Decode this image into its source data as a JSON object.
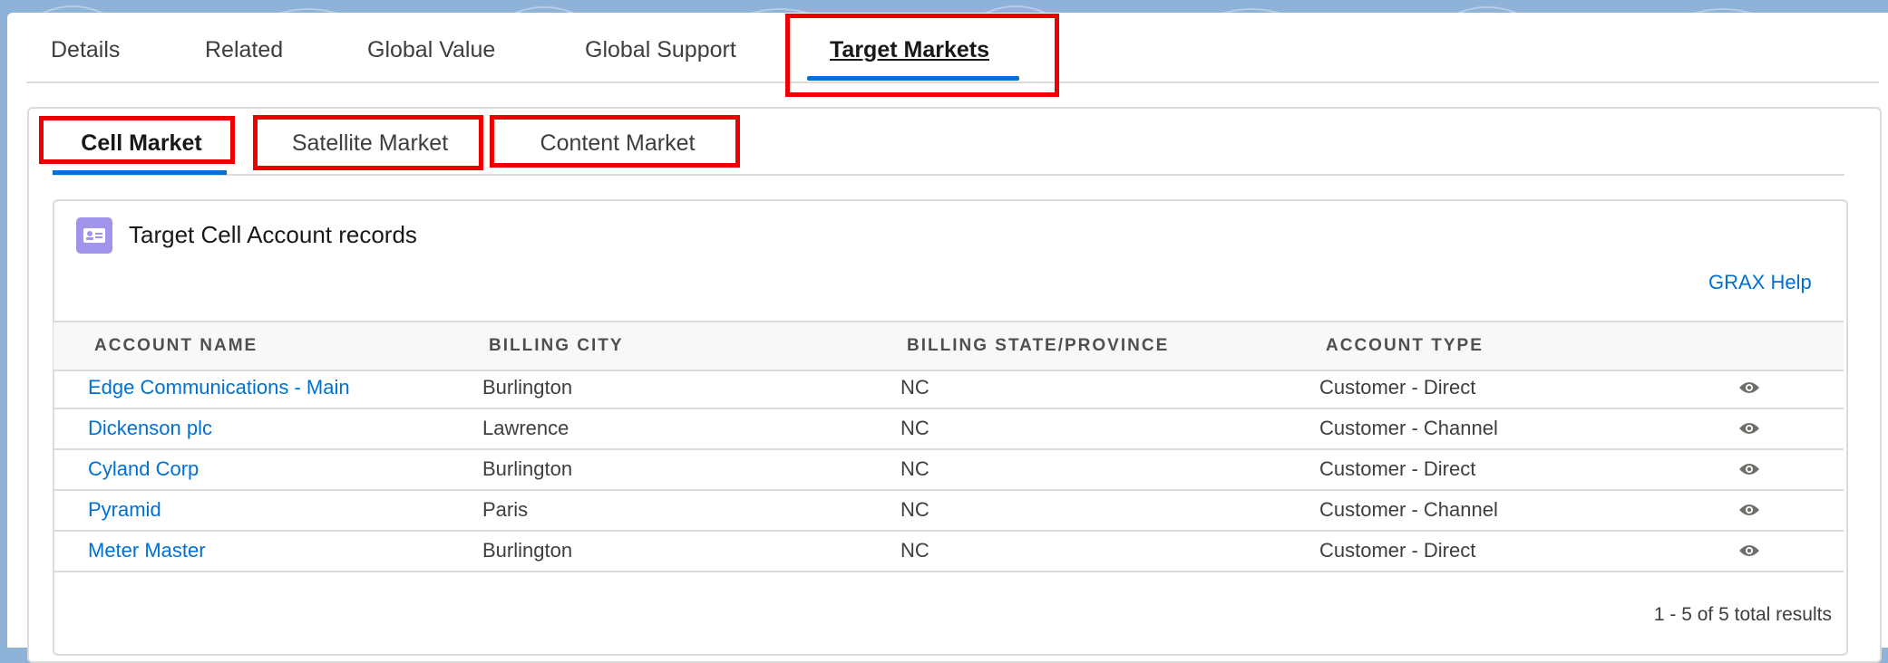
{
  "top_tabs": [
    "Details",
    "Related",
    "Global Value",
    "Global Support",
    "Target Markets"
  ],
  "active_top_tab": "Target Markets",
  "sub_tabs": [
    "Cell Market",
    "Satellite Market",
    "Content Market"
  ],
  "active_sub_tab": "Cell Market",
  "records": {
    "icon": "contact-card-icon",
    "title": "Target Cell Account records",
    "help_link": "GRAX Help",
    "columns": [
      "ACCOUNT NAME",
      "BILLING CITY",
      "BILLING STATE/PROVINCE",
      "ACCOUNT TYPE"
    ],
    "rows": [
      {
        "name": "Edge Communications - Main",
        "city": "Burlington",
        "state": "NC",
        "type": "Customer - Direct"
      },
      {
        "name": "Dickenson plc",
        "city": "Lawrence",
        "state": "NC",
        "type": "Customer - Channel"
      },
      {
        "name": "Cyland Corp",
        "city": "Burlington",
        "state": "NC",
        "type": "Customer - Direct"
      },
      {
        "name": "Pyramid",
        "city": "Paris",
        "state": "NC",
        "type": "Customer - Channel"
      },
      {
        "name": "Meter Master",
        "city": "Burlington",
        "state": "NC",
        "type": "Customer - Direct"
      }
    ],
    "row_action_icon": "eye-icon",
    "results_text": "1 - 5 of 5 total results"
  },
  "colors": {
    "brand_blue": "#0070d2",
    "annotation_red": "#ee0000",
    "background": "#8fb2d9",
    "record_icon": "#a094ed"
  }
}
